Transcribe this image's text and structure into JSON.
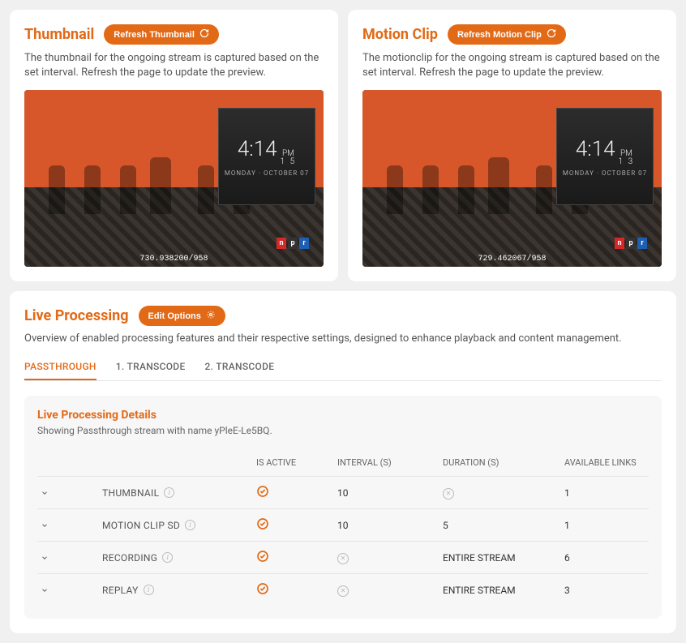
{
  "thumbnail": {
    "title": "Thumbnail",
    "refresh_label": "Refresh Thumbnail",
    "desc": "The thumbnail for the ongoing stream is captured based on the set interval. Refresh the page to update the preview.",
    "clock_time": "4:14",
    "clock_ampm": "PM",
    "clock_sec": "1 5",
    "clock_date": "Monday · October 07",
    "meta": "730.938200/958"
  },
  "motion": {
    "title": "Motion Clip",
    "refresh_label": "Refresh Motion Clip",
    "desc": "The motionclip for the ongoing stream is captured based on the set interval. Refresh the page to update the preview.",
    "clock_time": "4:14",
    "clock_ampm": "PM",
    "clock_sec": "1 3",
    "clock_date": "Monday · October 07",
    "meta": "729.462067/958"
  },
  "live": {
    "title": "Live Processing",
    "edit_label": "Edit Options",
    "desc": "Overview of enabled processing features and their respective settings, designed to enhance playback and content management.",
    "tabs": [
      "PASSTHROUGH",
      "1. TRANSCODE",
      "2. TRANSCODE"
    ],
    "details_title": "Live Processing Details",
    "details_sub": "Showing Passthrough stream with name yPleE-Le5BQ.",
    "columns": {
      "active": "IS ACTIVE",
      "interval": "INTERVAL (S)",
      "duration": "DURATION (S)",
      "links": "AVAILABLE LINKS"
    },
    "rows": [
      {
        "name": "THUMBNAIL",
        "active": true,
        "interval": "10",
        "duration_x": true,
        "duration": "",
        "links": "1"
      },
      {
        "name": "MOTION CLIP SD",
        "active": true,
        "interval": "10",
        "duration_x": false,
        "duration": "5",
        "links": "1"
      },
      {
        "name": "RECORDING",
        "active": true,
        "interval_x": true,
        "interval": "",
        "duration": "ENTIRE STREAM",
        "links": "6"
      },
      {
        "name": "REPLAY",
        "active": true,
        "interval_x": true,
        "interval": "",
        "duration": "ENTIRE STREAM",
        "links": "3"
      }
    ]
  }
}
